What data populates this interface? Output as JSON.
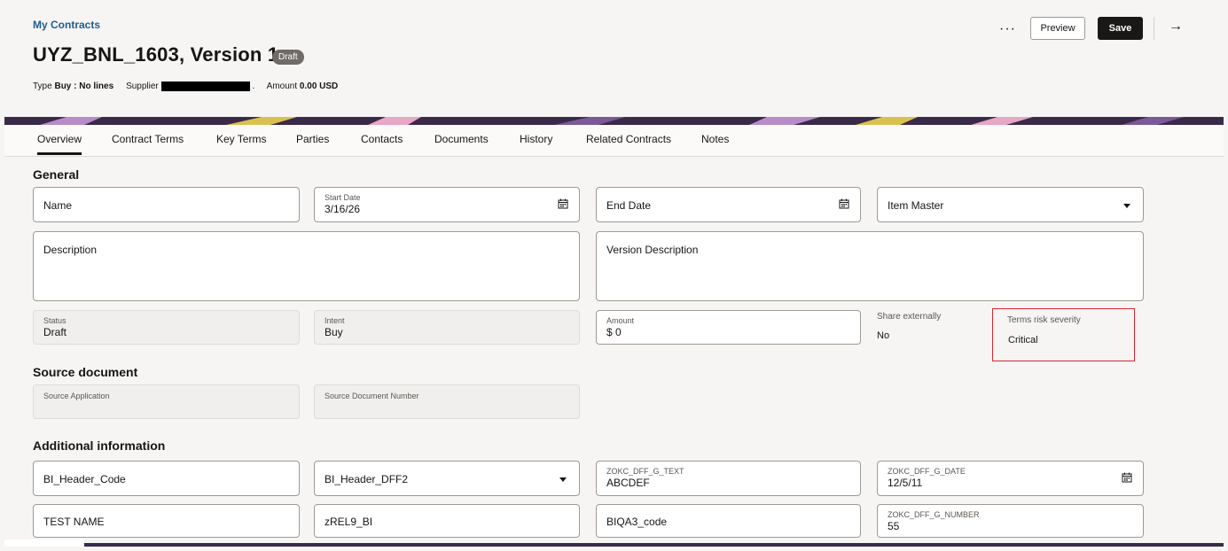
{
  "header": {
    "breadcrumb": "My Contracts",
    "title": "UYZ_BNL_1603, Version 1",
    "status_badge": "Draft",
    "type_label": "Type",
    "type_value": "Buy : No lines",
    "supplier_label": "Supplier",
    "amount_label": "Amount",
    "amount_value": "0.00 USD",
    "more_label": "···",
    "preview_label": "Preview",
    "save_label": "Save",
    "arrow_label": "→"
  },
  "tabs": [
    "Overview",
    "Contract Terms",
    "Key Terms",
    "Parties",
    "Contacts",
    "Documents",
    "History",
    "Related Contracts",
    "Notes"
  ],
  "general": {
    "heading": "General",
    "name_placeholder": "Name",
    "start_date_label": "Start Date",
    "start_date_value": "3/16/26",
    "end_date_placeholder": "End Date",
    "item_master_placeholder": "Item Master",
    "description_placeholder": "Description",
    "version_description_placeholder": "Version Description",
    "status_label": "Status",
    "status_value": "Draft",
    "intent_label": "Intent",
    "intent_value": "Buy",
    "amount_label": "Amount",
    "amount_value": "$ 0",
    "share_label": "Share externally",
    "share_value": "No",
    "risk_label": "Terms risk severity",
    "risk_value": "Critical"
  },
  "source": {
    "heading": "Source document",
    "application_label": "Source Application",
    "doc_number_label": "Source Document Number"
  },
  "additional": {
    "heading": "Additional information",
    "bi_header_code": "BI_Header_Code",
    "bi_header_dff2": "BI_Header_DFF2",
    "text_label": "ZOKC_DFF_G_TEXT",
    "text_value": "ABCDEF",
    "date_label": "ZOKC_DFF_G_DATE",
    "date_value": "12/5/11",
    "test_name": "TEST NAME",
    "zrel9": "zREL9_BI",
    "biqa3": "BIQA3_code",
    "number_label": "ZOKC_DFF_G_NUMBER",
    "number_value": "55"
  },
  "colors": {
    "accent_link": "#1f5c8c",
    "save_button": "#1a1816",
    "risk_highlight": "#d9262e",
    "banner": "#3a2a4a"
  }
}
